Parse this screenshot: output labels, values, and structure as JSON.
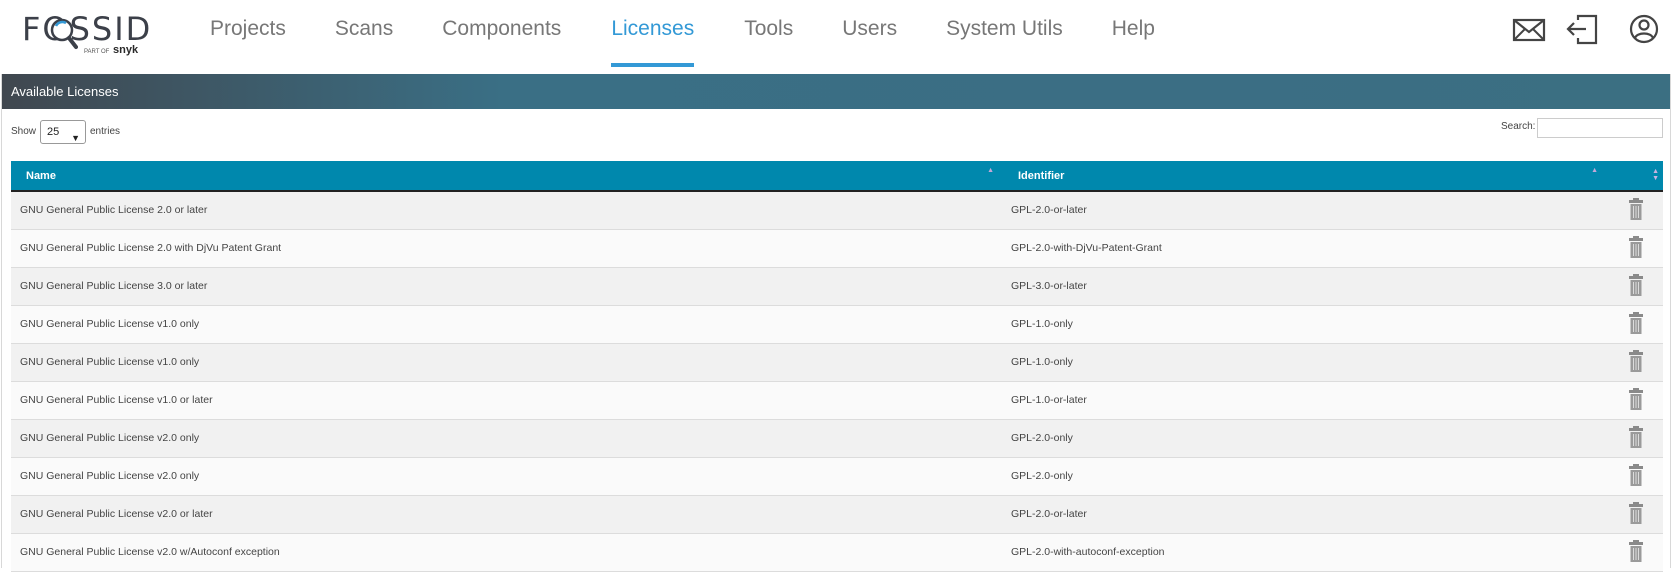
{
  "brand": {
    "name": "FOSSID",
    "tagline_prefix": "PART OF",
    "tagline_brand": "snyk"
  },
  "nav": {
    "items": [
      {
        "label": "Projects",
        "active": false
      },
      {
        "label": "Scans",
        "active": false
      },
      {
        "label": "Components",
        "active": false
      },
      {
        "label": "Licenses",
        "active": true
      },
      {
        "label": "Tools",
        "active": false
      },
      {
        "label": "Users",
        "active": false
      },
      {
        "label": "System Utils",
        "active": false
      },
      {
        "label": "Help",
        "active": false
      }
    ]
  },
  "top_icons": [
    "mail-icon",
    "logout-icon",
    "user-account-icon"
  ],
  "panel": {
    "title": "Available Licenses"
  },
  "table_controls": {
    "show_label": "Show",
    "page_length": "25",
    "entries_label": "entries",
    "search_label": "Search:",
    "search_value": ""
  },
  "table": {
    "columns": [
      "Name",
      "Identifier"
    ],
    "rows": [
      {
        "name": "GNU General Public License 2.0 or later",
        "identifier": "GPL-2.0-or-later"
      },
      {
        "name": "GNU General Public License 2.0 with DjVu Patent Grant",
        "identifier": "GPL-2.0-with-DjVu-Patent-Grant"
      },
      {
        "name": "GNU General Public License 3.0 or later",
        "identifier": "GPL-3.0-or-later"
      },
      {
        "name": "GNU General Public License v1.0 only",
        "identifier": "GPL-1.0-only"
      },
      {
        "name": "GNU General Public License v1.0 only",
        "identifier": "GPL-1.0-only"
      },
      {
        "name": "GNU General Public License v1.0 or later",
        "identifier": "GPL-1.0-or-later"
      },
      {
        "name": "GNU General Public License v2.0 only",
        "identifier": "GPL-2.0-only"
      },
      {
        "name": "GNU General Public License v2.0 only",
        "identifier": "GPL-2.0-only"
      },
      {
        "name": "GNU General Public License v2.0 or later",
        "identifier": "GPL-2.0-or-later"
      },
      {
        "name": "GNU General Public License v2.0 w/Autoconf exception",
        "identifier": "GPL-2.0-with-autoconf-exception"
      }
    ],
    "row_action_icon": "trash-icon"
  },
  "colors": {
    "accent": "#3399d6",
    "table_header": "#0088ad",
    "nav_text": "#777777"
  }
}
